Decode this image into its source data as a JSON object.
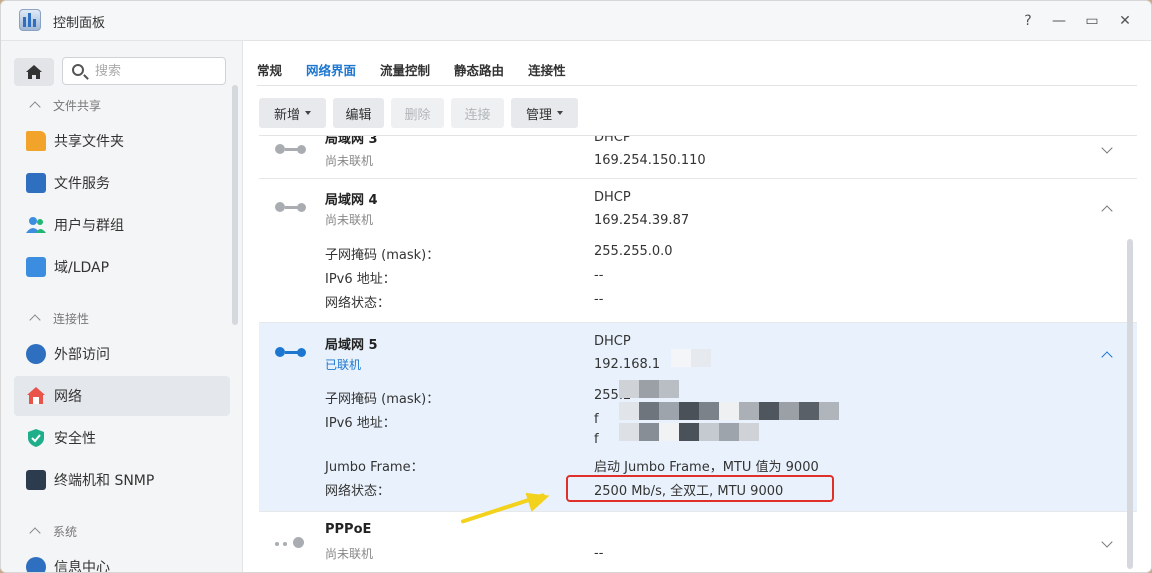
{
  "window": {
    "title": "控制面板"
  },
  "title_buttons": {
    "help": "?",
    "minimize": "—",
    "maximize": "▭",
    "close": "✕"
  },
  "sidebar": {
    "search_placeholder": "搜索",
    "sections": [
      {
        "label": "文件共享",
        "items": [
          {
            "label": "共享文件夹"
          },
          {
            "label": "文件服务"
          },
          {
            "label": "用户与群组"
          },
          {
            "label": "域/LDAP"
          }
        ]
      },
      {
        "label": "连接性",
        "items": [
          {
            "label": "外部访问"
          },
          {
            "label": "网络",
            "active": true
          },
          {
            "label": "安全性"
          },
          {
            "label": "终端机和 SNMP"
          }
        ]
      },
      {
        "label": "系统",
        "items": [
          {
            "label": "信息中心"
          }
        ]
      }
    ]
  },
  "tabs": [
    {
      "label": "常规"
    },
    {
      "label": "网络界面",
      "active": true
    },
    {
      "label": "流量控制"
    },
    {
      "label": "静态路由"
    },
    {
      "label": "连接性"
    }
  ],
  "toolbar": {
    "add": "新增",
    "edit": "编辑",
    "delete": "删除",
    "connect": "连接",
    "manage": "管理"
  },
  "interfaces": [
    {
      "name": "局域网 3",
      "status": "尚未联机",
      "mode": "DHCP",
      "ip": "169.254.150.110"
    },
    {
      "name": "局域网 4",
      "status": "尚未联机",
      "mode": "DHCP",
      "ip": "169.254.39.87",
      "details": {
        "mask_label": "子网掩码 (mask)：",
        "mask": "255.255.0.0",
        "ipv6_label": "IPv6 地址：",
        "ipv6": "--",
        "net_label": "网络状态：",
        "net": "--"
      }
    },
    {
      "name": "局域网 5",
      "status": "已联机",
      "mode": "DHCP",
      "ip": "192.168.1",
      "details": {
        "mask_label": "子网掩码 (mask)：",
        "mask": "255.2",
        "ipv6_label": "IPv6 地址：",
        "ipv6_1": "f",
        "ipv6_2": "f",
        "jumbo_label": "Jumbo Frame：",
        "jumbo": "启动 Jumbo Frame，MTU 值为 9000",
        "net_label": "网络状态：",
        "net": "2500 Mb/s, 全双工, MTU 9000"
      }
    },
    {
      "name": "PPPoE",
      "status": "尚未联机",
      "value": "--"
    }
  ],
  "colors": {
    "accent": "#1d77d0",
    "annotation_box": "#e0302a",
    "annotation_arrow": "#f3d21e"
  }
}
